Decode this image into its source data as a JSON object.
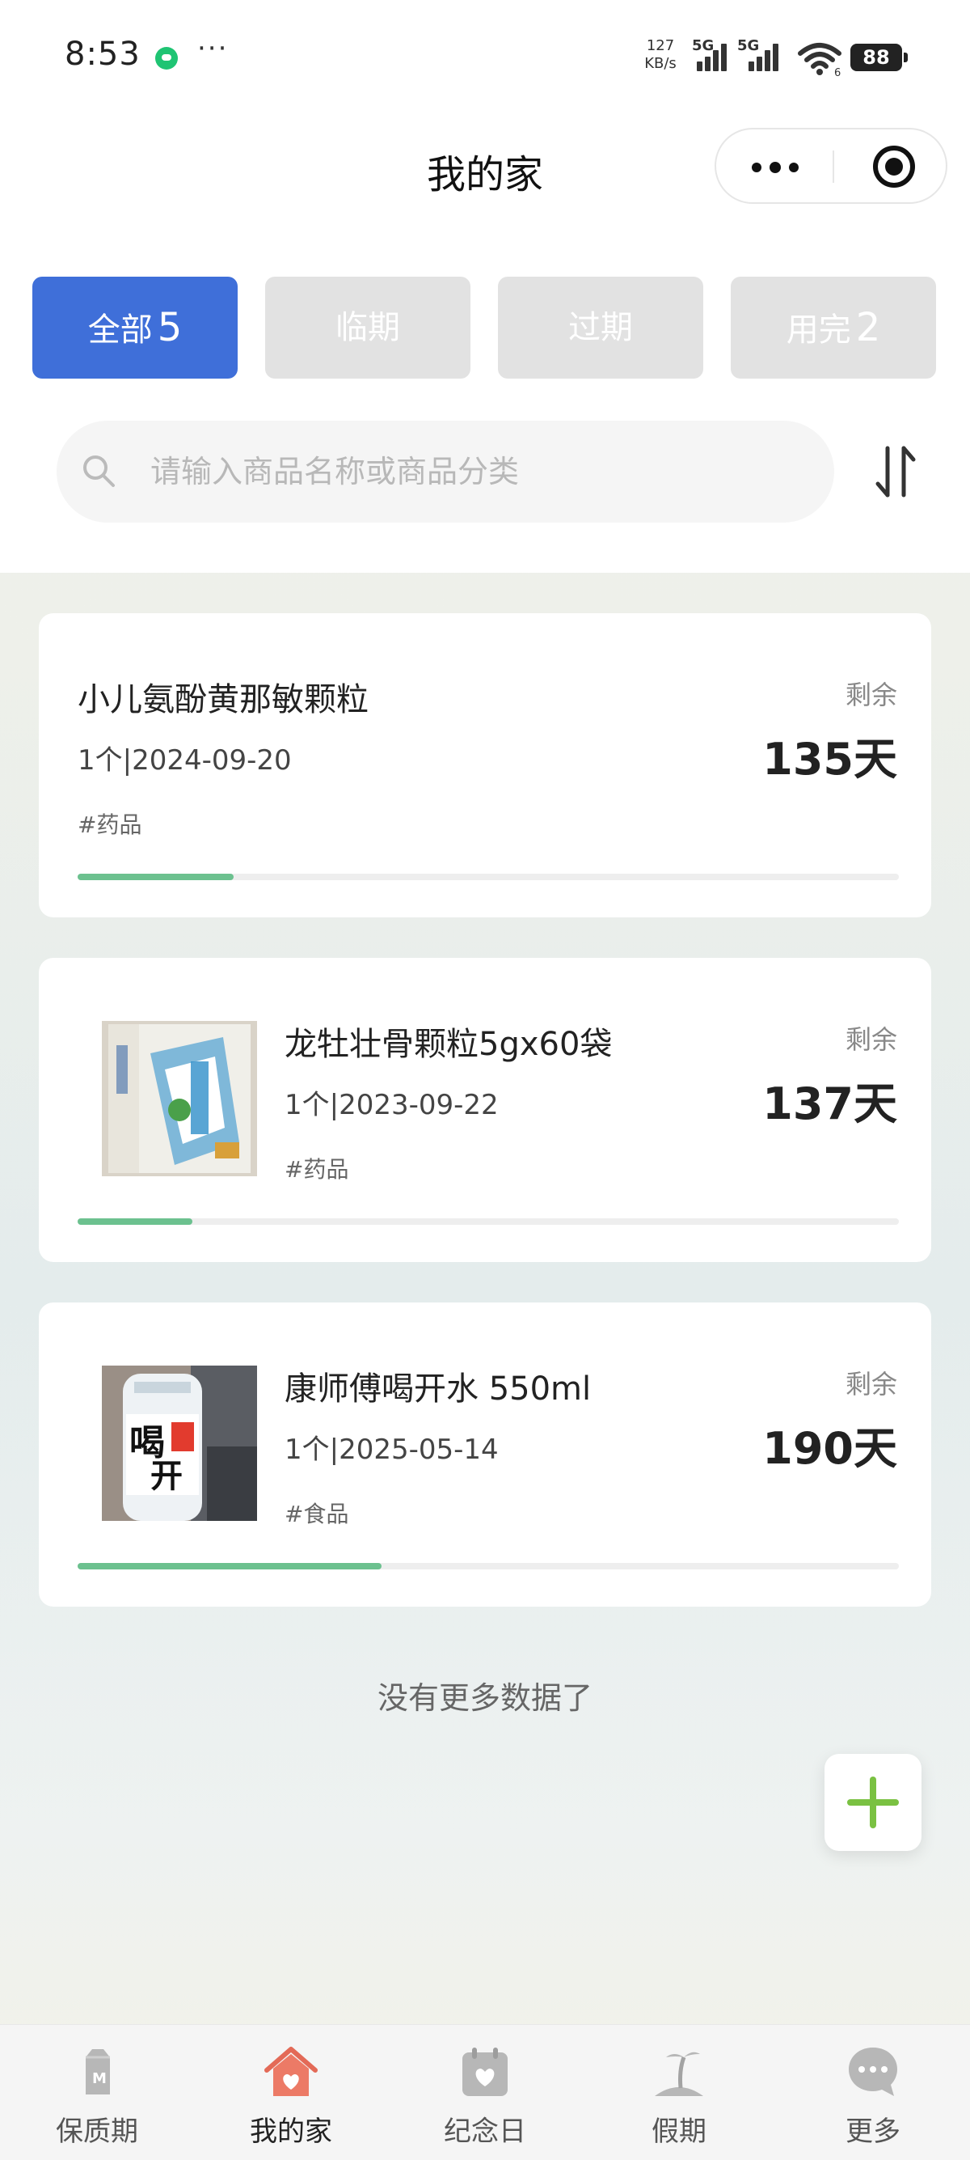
{
  "status_bar": {
    "time": "8:53",
    "more": "···",
    "net_speed_value": "127",
    "net_speed_unit": "KB/s",
    "sim1": "5G",
    "sim2": "5G",
    "wifi_sub": "6",
    "battery": "88"
  },
  "header": {
    "title": "我的家",
    "menu_icon": "more-dots-icon",
    "close_icon": "target-icon"
  },
  "tabs": [
    {
      "label": "全部",
      "count": "5",
      "active": true
    },
    {
      "label": "临期",
      "count": "",
      "active": false
    },
    {
      "label": "过期",
      "count": "",
      "active": false
    },
    {
      "label": "用完",
      "count": "2",
      "active": false
    }
  ],
  "search": {
    "placeholder": "请输入商品名称或商品分类",
    "sort_icon": "sort-icon"
  },
  "items": [
    {
      "name": "小儿氨酚黄那敏颗粒",
      "meta": "1个|2024-09-20",
      "category": "#药品",
      "remain_label": "剩余",
      "days": "135天",
      "progress": 0.19,
      "has_image": false
    },
    {
      "name": "龙牡壮骨颗粒5gx60袋",
      "meta": "1个|2023-09-22",
      "category": "#药品",
      "remain_label": "剩余",
      "days": "137天",
      "progress": 0.14,
      "has_image": true
    },
    {
      "name": "康师傅喝开水 550ml",
      "meta": "1个|2025-05-14",
      "category": "#食品",
      "remain_label": "剩余",
      "days": "190天",
      "progress": 0.37,
      "has_image": true
    }
  ],
  "footer_text": "没有更多数据了",
  "fab_icon": "plus-icon",
  "colors": {
    "accent": "#3f6fd9",
    "progress": "#6cc18f",
    "fab_plus": "#7ac142",
    "tab_inactive": "#e2e2e2"
  },
  "bottom_nav": [
    {
      "label": "保质期",
      "icon": "milk-carton-icon",
      "active": false
    },
    {
      "label": "我的家",
      "icon": "home-icon",
      "active": true
    },
    {
      "label": "纪念日",
      "icon": "calendar-heart-icon",
      "active": false
    },
    {
      "label": "假期",
      "icon": "island-icon",
      "active": false
    },
    {
      "label": "更多",
      "icon": "chat-bubble-icon",
      "active": false
    }
  ]
}
